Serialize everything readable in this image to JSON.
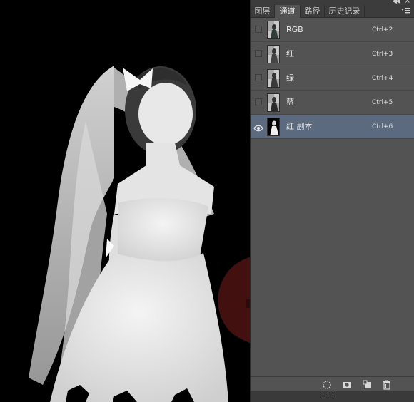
{
  "panel": {
    "tabs": [
      {
        "label": "图层",
        "active": false
      },
      {
        "label": "通道",
        "active": true
      },
      {
        "label": "路径",
        "active": false
      },
      {
        "label": "历史记录",
        "active": false
      }
    ],
    "channels": [
      {
        "name": "RGB",
        "shortcut": "Ctrl+2",
        "visible": false,
        "selected": false
      },
      {
        "name": "红",
        "shortcut": "Ctrl+3",
        "visible": false,
        "selected": false
      },
      {
        "name": "绿",
        "shortcut": "Ctrl+4",
        "visible": false,
        "selected": false
      },
      {
        "name": "蓝",
        "shortcut": "Ctrl+5",
        "visible": false,
        "selected": false
      },
      {
        "name": "红 副本",
        "shortcut": "Ctrl+6",
        "visible": true,
        "selected": true
      }
    ],
    "bottom_icons": [
      "dotted-circle-icon",
      "mask-icon",
      "new-channel-icon",
      "trash-icon"
    ]
  },
  "colors": {
    "panel_bg": "#535353",
    "tab_bar_bg": "#3c3c3c",
    "selected_row": "#5c6a80",
    "canvas_bg": "#000000",
    "watermark": "#7a1e1e"
  }
}
